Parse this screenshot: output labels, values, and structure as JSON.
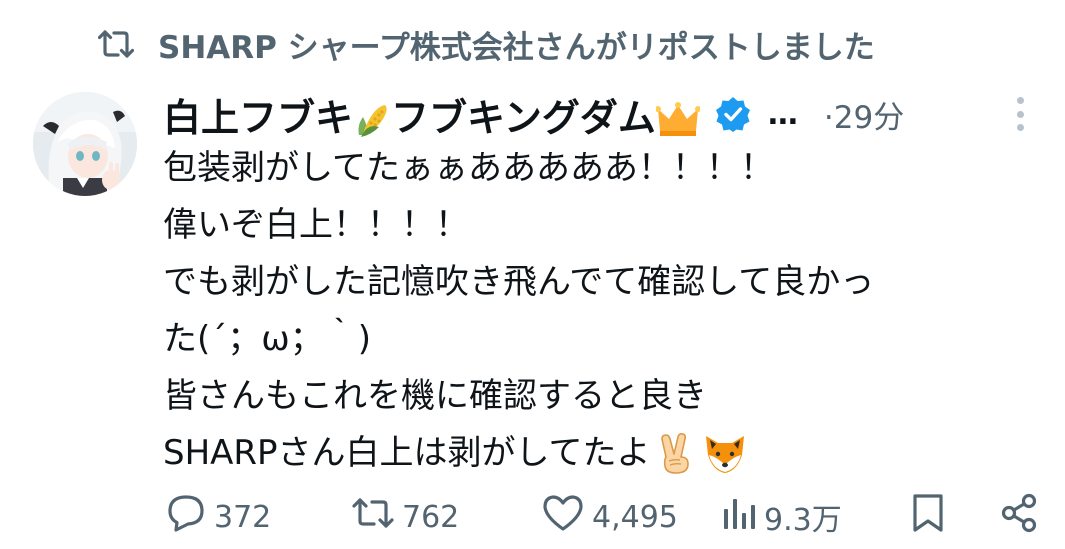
{
  "repost": {
    "icon": "repost-icon",
    "text": "SHARP シャープ株式会社さんがリポストしました"
  },
  "avatar": {
    "icon": "avatar-anime-girl"
  },
  "header": {
    "name_part1": "白上フブキ",
    "name_emoji1": "corn-emoji",
    "name_part2": "フブキングダム",
    "name_emoji2": "crown-emoji",
    "verified_icon": "verified-badge-icon",
    "ellipsis": "…",
    "time": "·29分",
    "more_icon": "more-vertical-icon"
  },
  "body": {
    "lines": [
      "包装剥がしてたぁぁあああああ！！！！",
      "偉いぞ白上！！！！",
      "でも剥がした記憶吹き飛んでて確認して良かっ",
      "た(´；ω；｀)",
      "皆さんもこれを機に確認すると良き",
      "SHARPさん白上は剥がしてたよ"
    ],
    "end_emojis": [
      "victory-hand-emoji",
      "fox-emoji"
    ]
  },
  "actions": {
    "reply": {
      "icon": "reply-icon",
      "count": "372"
    },
    "repost": {
      "icon": "repost-icon",
      "count": "762"
    },
    "like": {
      "icon": "heart-icon",
      "count": "4,495"
    },
    "views": {
      "icon": "views-chart-icon",
      "count": "9.3万"
    },
    "bookmark": {
      "icon": "bookmark-icon"
    },
    "share": {
      "icon": "share-icon"
    }
  },
  "colors": {
    "text_primary": "#0f1419",
    "text_secondary": "#536471",
    "verified_blue": "#1d9bf0"
  }
}
